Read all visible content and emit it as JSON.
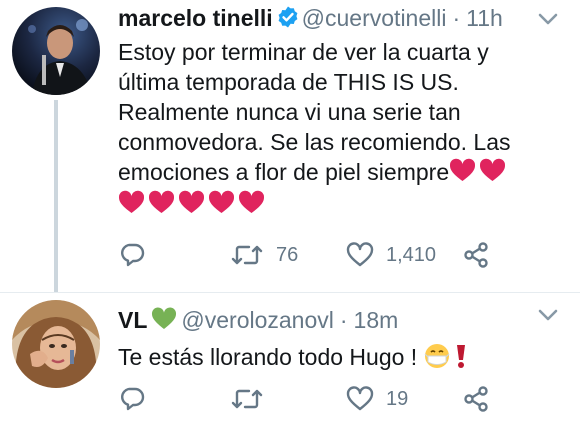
{
  "tweets": [
    {
      "author_name": "marcelo tinelli",
      "handle": "@cuervotinelli",
      "separator": "·",
      "time": "11h",
      "text_line1": "Estoy por terminar de ver la cuarta y",
      "text_line2": "última temporada de THIS IS US.",
      "text_line3": "Realmente nunca vi una serie tan",
      "text_line4": "conmovedora. Se las recomiendo. Las",
      "text_line5": "emociones a flor de piel siempre",
      "heart_emoji_count": 7,
      "retweet_count": "76",
      "like_count": "1,410",
      "verified": true
    },
    {
      "author_name": "VL",
      "handle": "@verolozanovl",
      "separator": "·",
      "time": "18m",
      "text": "Te estás llorando todo Hugo ! ",
      "retweet_count": "",
      "like_count": "19",
      "name_emoji": "green-heart-icon",
      "trailing_emojis": [
        "face-with-mask-icon",
        "red-exclamation-icon"
      ]
    }
  ],
  "colors": {
    "text": "#14171a",
    "secondary": "#657786",
    "verified": "#1da1f2",
    "heart_red": "#e0245e",
    "green_heart": "#77b255",
    "thread_line": "#ccd6dd"
  }
}
